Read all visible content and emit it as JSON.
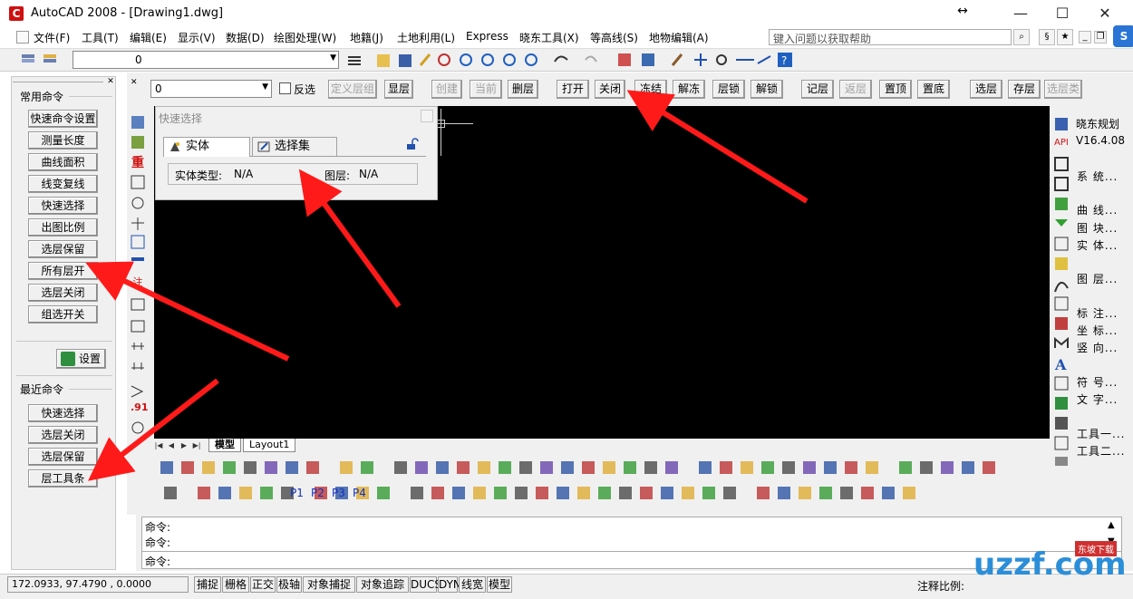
{
  "window": {
    "title": "AutoCAD 2008 - [Drawing1.dwg]",
    "app_icon_letter": "C",
    "move_glyph": "↔",
    "minimize": "—",
    "maximize": "☐",
    "close": "✕"
  },
  "menu": {
    "items": [
      "文件(F)",
      "工具(T)",
      "编辑(E)",
      "显示(V)",
      "数据(D)",
      "绘图处理(W)",
      "地籍(J)",
      "土地利用(L)",
      "Express",
      "晓东工具(X)",
      "等高线(S)",
      "地物编辑(A)"
    ],
    "help_placeholder": "键入问题以获取帮助",
    "badge": "S"
  },
  "toolbar1": {
    "layer_value": "0"
  },
  "left_panel": {
    "common_title": "常用命令",
    "common_buttons": [
      "快速命令设置",
      "测量长度",
      "曲线面积",
      "线变复线",
      "快速选择",
      "出图比例",
      "选层保留",
      "所有层开",
      "选层关闭",
      "组选开关"
    ],
    "settings_label": "设置",
    "recent_title": "最近命令",
    "recent_buttons": [
      "快速选择",
      "选层关闭",
      "选层保留",
      "层工具条"
    ]
  },
  "layer_toolbar": {
    "layer_value": "0",
    "invert_label": "反选",
    "buttons": [
      {
        "label": "定义层组",
        "disabled": true
      },
      {
        "label": "显层",
        "disabled": false
      },
      {
        "label": "创建",
        "disabled": true
      },
      {
        "label": "当前",
        "disabled": true
      },
      {
        "label": "删层",
        "disabled": false
      },
      {
        "label": "打开",
        "disabled": false
      },
      {
        "label": "关闭",
        "disabled": false
      },
      {
        "label": "冻结",
        "disabled": false
      },
      {
        "label": "解冻",
        "disabled": false
      },
      {
        "label": "层锁",
        "disabled": false
      },
      {
        "label": "解锁",
        "disabled": false
      },
      {
        "label": "记层",
        "disabled": false
      },
      {
        "label": "返层",
        "disabled": true
      },
      {
        "label": "置顶",
        "disabled": false
      },
      {
        "label": "置底",
        "disabled": false
      },
      {
        "label": "选层",
        "disabled": false
      },
      {
        "label": "存层",
        "disabled": false
      },
      {
        "label": "选层类",
        "disabled": true
      }
    ]
  },
  "vertical_toolbar": {
    "glyphs": [
      "重",
      "注",
      ".91"
    ]
  },
  "quick_select": {
    "title": "快速选择",
    "tab_entity": "实体",
    "tab_selection": "选择集",
    "entity_type_label": "实体类型:",
    "entity_type_value": "N/A",
    "layer_label": "图层:",
    "layer_value": "N/A"
  },
  "layout_tabs": {
    "model": "模型",
    "layout1": "Layout1"
  },
  "bottom_toolbar": {
    "p_labels": [
      "P1",
      "P2",
      "P3",
      "P4"
    ]
  },
  "right_panel": {
    "title": "晓东规划",
    "version": "V16.4.08",
    "api_label": "API",
    "items": [
      "系    统...",
      "曲    线...",
      "图    块...",
      "实    体...",
      "图    层...",
      "标    注...",
      "坐    标...",
      "竖    向...",
      "符    号...",
      "文    字...",
      "工具一...",
      "工具二..."
    ]
  },
  "command": {
    "lines": [
      "命令:",
      "命令:",
      "命令:"
    ]
  },
  "status": {
    "coords": "172.0933, 97.4790 , 0.0000",
    "toggles": [
      "捕捉",
      "栅格",
      "正交",
      "极轴",
      "对象捕捉",
      "对象追踪",
      "DUCS",
      "DYN",
      "线宽",
      "模型"
    ],
    "scale_label": "注释比例:"
  },
  "watermark": {
    "logo": "uzzf.com",
    "tag": "东坡下载"
  },
  "colors": {
    "accent_red": "#ff1a1a",
    "canvas": "#000000",
    "panel": "#f0f0f0"
  }
}
